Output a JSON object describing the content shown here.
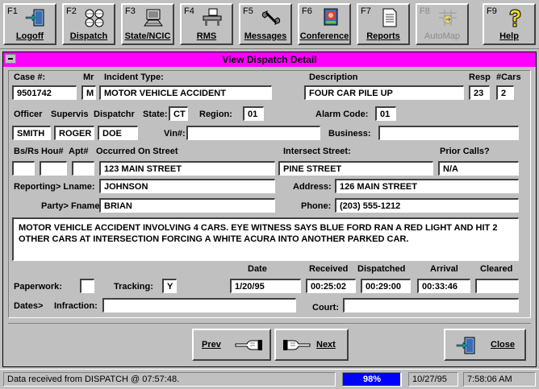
{
  "toolbar": {
    "buttons": [
      {
        "fkey": "F1",
        "label": "Logoff",
        "icon": "logoff-door-icon"
      },
      {
        "fkey": "F2",
        "label": "Dispatch",
        "icon": "dispatch-globes-icon"
      },
      {
        "fkey": "F3",
        "label": "State/NCIC",
        "icon": "computer-terminal-icon"
      },
      {
        "fkey": "F4",
        "label": "RMS",
        "icon": "records-desk-icon"
      },
      {
        "fkey": "F5",
        "label": "Messages",
        "icon": "telephone-icon"
      },
      {
        "fkey": "F6",
        "label": "Conference",
        "icon": "conference-icon"
      },
      {
        "fkey": "F7",
        "label": "Reports",
        "icon": "report-document-icon"
      },
      {
        "fkey": "F8",
        "label": "AutoMap",
        "icon": "automap-icon"
      },
      {
        "fkey": "F9",
        "label": "Help",
        "icon": "help-question-icon"
      }
    ]
  },
  "dialog": {
    "title": "View Dispatch Detail",
    "labels": {
      "case": "Case #:",
      "mr": "Mr",
      "incident_type": "Incident Type:",
      "description": "Description",
      "resp": "Resp",
      "ncars": "#Cars",
      "officer": "Officer",
      "supervis": "Supervis",
      "dispatchr": "Dispatchr",
      "state": "State:",
      "region": "Region:",
      "alarm_code": "Alarm Code:",
      "vin": "Vin#:",
      "business": "Business:",
      "bsrs": "Bs/Rs",
      "hou": "Hou#",
      "apt": "Apt#",
      "occurred_on": "Occurred On Street",
      "intersect": "Intersect Street:",
      "prior_calls": "Prior Calls?",
      "reporting": "Reporting> Lname:",
      "address": "Address:",
      "party": "Party> Fname:",
      "phone": "Phone:",
      "date": "Date",
      "received": "Received",
      "dispatched": "Dispatched",
      "arrival": "Arrival",
      "cleared": "Cleared",
      "paperwork": "Paperwork:",
      "tracking": "Tracking:",
      "dates": "Dates>",
      "infraction": "Infraction:",
      "court": "Court:"
    },
    "values": {
      "case": "9501742",
      "mr": "M",
      "incident_type": "MOTOR VEHICLE ACCIDENT",
      "description": "FOUR CAR PILE UP",
      "resp": "23",
      "ncars": "2",
      "state": "CT",
      "region": "01",
      "alarm_code": "01",
      "officer": "SMITH",
      "supervis": "ROGER",
      "dispatchr": "DOE",
      "vin": "",
      "business": "",
      "bsrs": "",
      "hou": "",
      "apt": "",
      "occurred_on": "123 MAIN STREET",
      "intersect": "PINE STREET",
      "prior_calls": "N/A",
      "lname": "JOHNSON",
      "address": "126 MAIN STREET",
      "fname": "BRIAN",
      "phone": "(203) 555-1212",
      "narrative": "MOTOR VEHICLE ACCIDENT INVOLVING 4 CARS. EYE WITNESS SAYS BLUE FORD RAN A RED LIGHT AND HIT 2 OTHER CARS AT INTERSECTION FORCING A WHITE ACURA INTO ANOTHER PARKED CAR.",
      "paperwork": "",
      "tracking": "Y",
      "date": "1/20/95",
      "received": "00:25:02",
      "dispatched": "00:29:00",
      "arrival": "00:33:46",
      "cleared": "",
      "infraction": "",
      "court": ""
    },
    "buttons": {
      "prev": "Prev",
      "next": "Next",
      "close": "Close"
    }
  },
  "statusbar": {
    "message": "Data received from DISPATCH @ 07:57:48.",
    "progress_label": "98%",
    "progress_value": 98,
    "date": "10/27/95",
    "time": "7:58:06 AM",
    "progress_color": "#0000ff"
  },
  "colors": {
    "titlebar": "#ff00ff",
    "face": "#c0c0c0"
  }
}
